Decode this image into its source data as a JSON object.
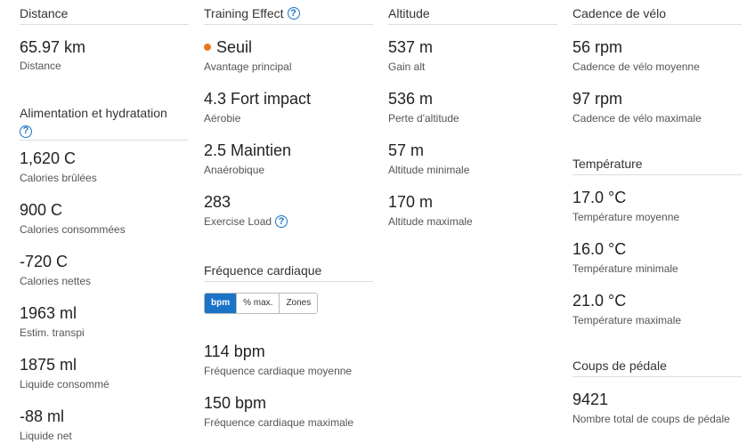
{
  "distance": {
    "title": "Distance",
    "stats": [
      {
        "value": "65.97 km",
        "label": "Distance"
      }
    ]
  },
  "nutrition": {
    "title": "Alimentation et hydratation",
    "help_icon": "?",
    "stats": [
      {
        "value": "1,620 C",
        "label": "Calories brûlées"
      },
      {
        "value": "900 C",
        "label": "Calories consommées"
      },
      {
        "value": "-720 C",
        "label": "Calories nettes"
      },
      {
        "value": "1963 ml",
        "label": "Estim. transpi"
      },
      {
        "value": "1875 ml",
        "label": "Liquide consommé"
      },
      {
        "value": "-88 ml",
        "label": "Liquide net"
      }
    ]
  },
  "training_effect": {
    "title": "Training Effect",
    "help_icon": "?",
    "primary": {
      "value": "Seuil",
      "label": "Avantage principal",
      "dot_color": "#e87722"
    },
    "aerobic": {
      "value": "4.3 Fort impact",
      "label": "Aérobie"
    },
    "anaerobic": {
      "value": "2.5 Maintien",
      "label": "Anaérobique"
    },
    "load": {
      "value": "283",
      "label": "Exercise Load",
      "help_icon": "?"
    }
  },
  "heart_rate": {
    "title": "Fréquence cardiaque",
    "tabs": [
      "bpm",
      "% max.",
      "Zones"
    ],
    "active_tab": "bpm",
    "stats": [
      {
        "value": "114 bpm",
        "label": "Fréquence cardiaque moyenne"
      },
      {
        "value": "150 bpm",
        "label": "Fréquence cardiaque maximale"
      }
    ]
  },
  "altitude": {
    "title": "Altitude",
    "stats": [
      {
        "value": "537 m",
        "label": "Gain alt"
      },
      {
        "value": "536 m",
        "label": "Perte d'altitude"
      },
      {
        "value": "57 m",
        "label": "Altitude minimale"
      },
      {
        "value": "170 m",
        "label": "Altitude maximale"
      }
    ]
  },
  "cadence": {
    "title": "Cadence de vélo",
    "stats": [
      {
        "value": "56 rpm",
        "label": "Cadence de vélo moyenne"
      },
      {
        "value": "97 rpm",
        "label": "Cadence de vélo maximale"
      }
    ]
  },
  "temperature": {
    "title": "Température",
    "stats": [
      {
        "value": "17.0 °C",
        "label": "Température moyenne"
      },
      {
        "value": "16.0 °C",
        "label": "Température minimale"
      },
      {
        "value": "21.0 °C",
        "label": "Température maximale"
      }
    ]
  },
  "pedal": {
    "title": "Coups de pédale",
    "stats": [
      {
        "value": "9421",
        "label": "Nombre total de coups de pédale"
      }
    ]
  },
  "colors": {
    "accent": "#1a73c6",
    "primary_dot": "#e87722"
  }
}
